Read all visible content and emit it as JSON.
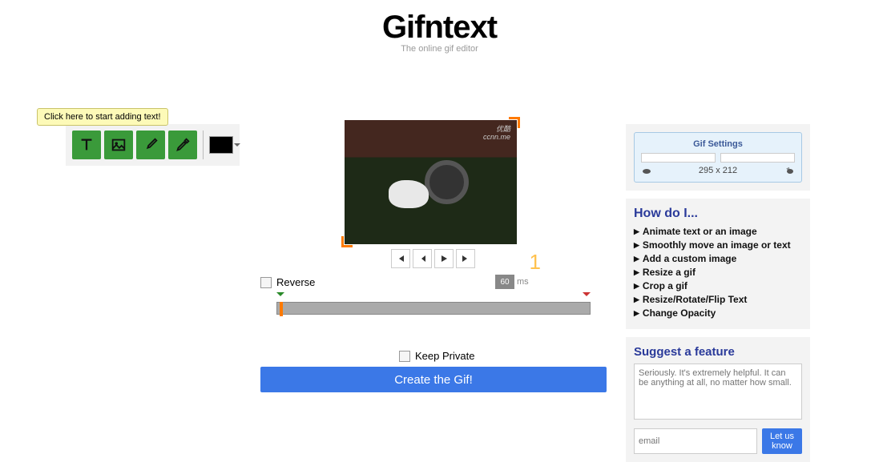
{
  "header": {
    "logo": "Gifntext",
    "tagline": "The online gif editor"
  },
  "tooltip": {
    "text": "Click here to start adding text!"
  },
  "tools": {
    "text": "text-tool",
    "image": "image-tool",
    "draw": "draw-tool",
    "picker": "eyedropper-tool"
  },
  "gif": {
    "watermark1": "优酷",
    "watermark2": "ccnn.me",
    "frame_number": "1"
  },
  "controls": {
    "reverse_label": "Reverse",
    "delay_value": "60",
    "delay_unit": "ms",
    "keep_private_label": "Keep Private",
    "create_label": "Create the Gif!"
  },
  "settings": {
    "title": "Gif Settings",
    "dimensions": "295 x 212"
  },
  "howdo": {
    "title": "How do I...",
    "items": [
      "Animate text or an image",
      "Smoothly move an image or text",
      "Add a custom image",
      "Resize a gif",
      "Crop a gif",
      "Resize/Rotate/Flip Text",
      "Change Opacity"
    ]
  },
  "suggest": {
    "title": "Suggest a feature",
    "placeholder": "Seriously. It's extremely helpful. It can be anything at all, no matter how small.",
    "email_placeholder": "email",
    "button": "Let us know"
  }
}
